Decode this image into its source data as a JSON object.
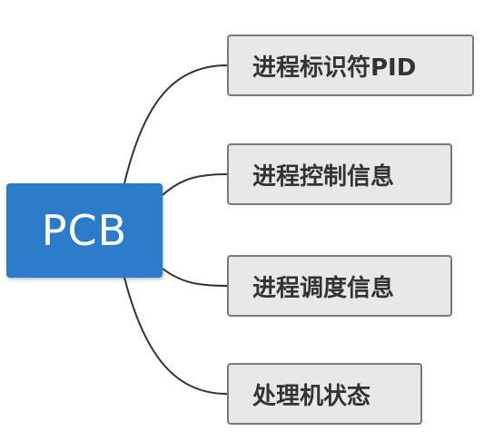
{
  "root": {
    "label": "PCB",
    "color": "#2b7bc8"
  },
  "children": [
    {
      "label": "进程标识符PID"
    },
    {
      "label": "进程控制信息"
    },
    {
      "label": "进程调度信息"
    },
    {
      "label": "处理机状态"
    }
  ],
  "colors": {
    "child_fill": "#e8e8e8",
    "child_border": "#7a7a7a",
    "connector": "#333333"
  }
}
